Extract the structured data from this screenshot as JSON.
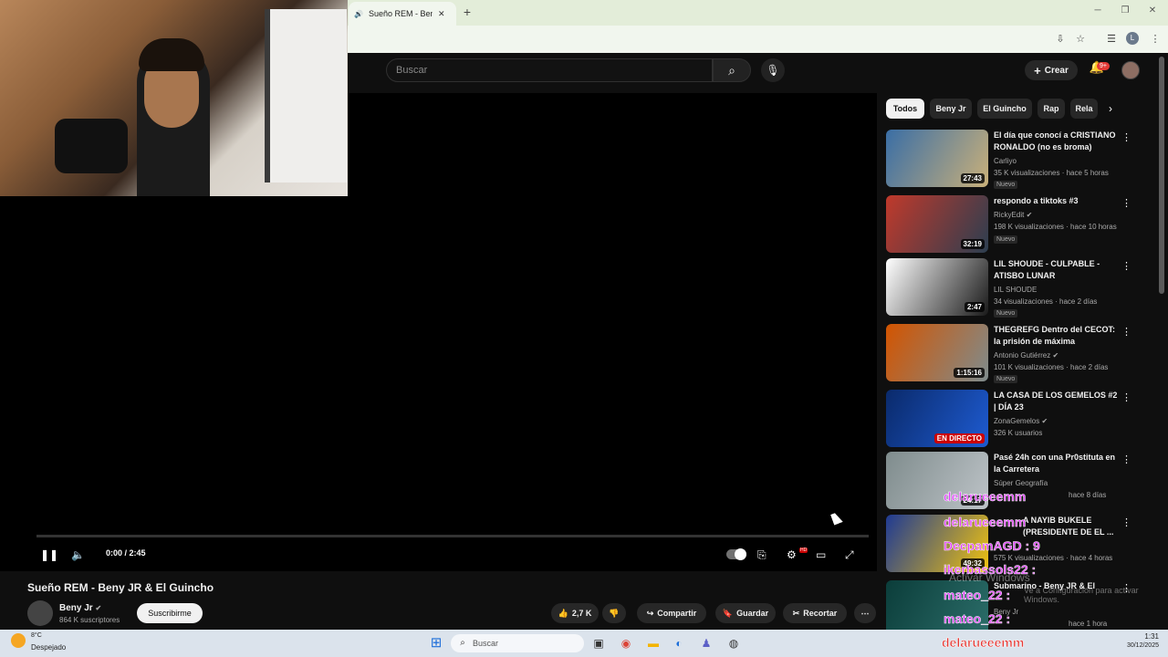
{
  "browser": {
    "tab_title": "Sueño REM - Beny J",
    "new_tab": "+",
    "close_tab": "✕",
    "minimize": "─",
    "restore": "❐",
    "close_window": "✕",
    "profile_initial": "L"
  },
  "header": {
    "search_placeholder": "Buscar",
    "create_label": "Crear",
    "notifications_badge": "9+"
  },
  "player": {
    "time": "0:00 / 2:45",
    "progress": 0.0,
    "hd_badge": "HD"
  },
  "video": {
    "title": "Sueño REM - Beny JR & El Guincho",
    "channel": "Beny Jr",
    "subscribers": "864 K suscriptores",
    "subscribe_label": "Suscribirme",
    "likes": "2,7 K",
    "share_label": "Compartir",
    "save_label": "Guardar",
    "clip_label": "Recortar"
  },
  "chips": [
    "Todos",
    "Beny Jr",
    "El Guincho",
    "Rap",
    "Rela"
  ],
  "recommendations": [
    {
      "title": "El día que conocí a CRISTIANO RONALDO (no es broma)",
      "channel": "Carliyo",
      "meta": "35 K visualizaciones · hace 5 horas",
      "badge": "Nuevo",
      "duration": "27:43",
      "colors": [
        "#3a6ea5",
        "#c9b07a"
      ]
    },
    {
      "title": "respondo a tiktoks #3",
      "channel": "RickyEdit",
      "meta": "198 K visualizaciones · hace 10 horas",
      "badge": "Nuevo",
      "duration": "32:19",
      "colors": [
        "#c0392b",
        "#2c3e50"
      ]
    },
    {
      "title": "LIL SHOUDE - CULPABLE - ATISBO LUNAR",
      "channel": "LIL SHOUDE",
      "meta": "34 visualizaciones · hace 2 días",
      "badge": "Nuevo",
      "duration": "2:47",
      "colors": [
        "#ffffff",
        "#1a1a1a"
      ]
    },
    {
      "title": "THEGREFG Dentro del CECOT: la prisión de máxima seguridad...",
      "channel": "Antonio Gutiérrez",
      "meta": "101 K visualizaciones · hace 2 días",
      "badge": "Nuevo",
      "duration": "1:15:16",
      "colors": [
        "#d35400",
        "#7f8c8d"
      ]
    },
    {
      "title": "LA CASA DE LOS GEMELOS #2 | DÍA 23",
      "channel": "ZonaGemelos",
      "meta": "326 K usuarios",
      "badge": "",
      "duration": "EN DIRECTO",
      "colors": [
        "#0a2a6b",
        "#1e5bd1"
      ]
    },
    {
      "title": "Pasé 24h con una Pr0stituta en la Carretera",
      "channel": "Súper Geografía",
      "meta": "hace 8 días",
      "badge": "",
      "duration": "24:17",
      "colors": [
        "#7f8c8d",
        "#bdc3c7"
      ]
    },
    {
      "title": "A NAYIB BUKELE (PRESIDENTE DE EL ...",
      "channel": "",
      "meta": "575 K visualizaciones · hace 4 horas",
      "badge": "",
      "duration": "49:32",
      "colors": [
        "#1f3a93",
        "#f1c40f"
      ]
    },
    {
      "title": "Submarino - Beny JR & El",
      "channel": "Beny Jr",
      "meta": "hace 1 hora",
      "badge": "",
      "duration": "",
      "colors": [
        "#0b3d3a",
        "#2c6e6a"
      ]
    }
  ],
  "chat_overlay": [
    "delarueeemm",
    "delarueeemm",
    "DeepamAGD : 9",
    "ikerbassols22 :",
    "mateo_22 :",
    "mateo_22 :"
  ],
  "windows_watermark": {
    "line1": "Activar Windows",
    "line2": "Ve a Configuración para activar Windows."
  },
  "taskbar": {
    "weather_temp": "8°C",
    "weather_desc": "Despejado",
    "search_placeholder": "Buscar",
    "time": "1:31",
    "date": "30/12/2025",
    "streamer_name": "delarueeemm"
  }
}
